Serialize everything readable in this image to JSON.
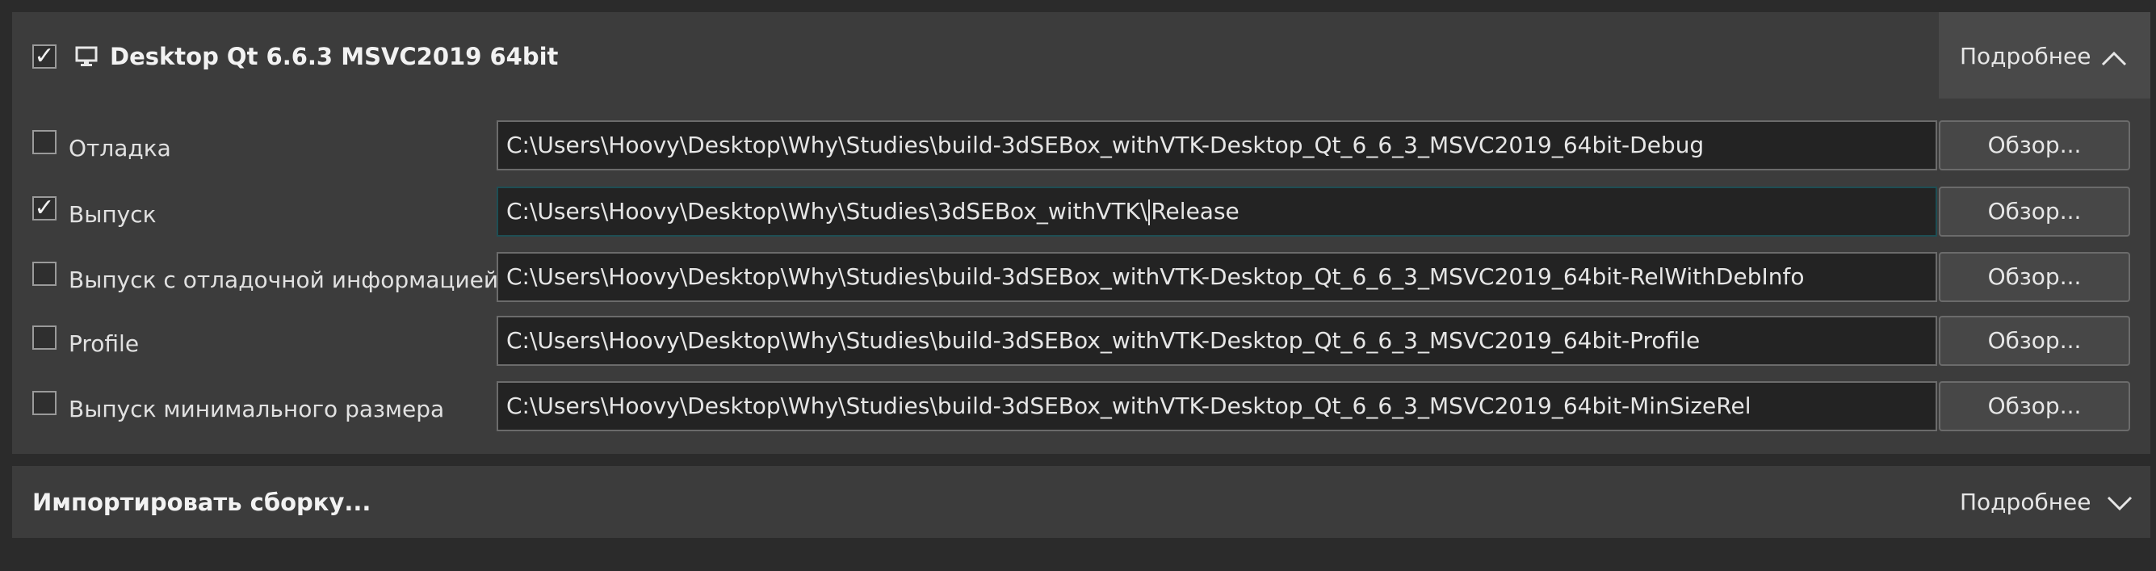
{
  "kit": {
    "checked": true,
    "title": "Desktop Qt 6.6.3 MSVC2019 64bit",
    "details_label": "Подробнее",
    "icon": "monitor-icon",
    "expanded": true
  },
  "build_configs": [
    {
      "name": "Отладка",
      "checked": false,
      "path_before_caret": "C:\\Users\\Hoovy\\Desktop\\Why\\Studies\\build-3dSEBox_withVTK-Desktop_Qt_6_6_3_MSVC2019_64bit-Debug",
      "path_after_caret": "",
      "browse_label": "Обзор..."
    },
    {
      "name": "Выпуск",
      "checked": true,
      "path_before_caret": "C:\\Users\\Hoovy\\Desktop\\Why\\Studies\\3dSEBox_withVTK\\",
      "path_after_caret": "Release",
      "browse_label": "Обзор..."
    },
    {
      "name": "Выпуск с отладочной информацией",
      "checked": false,
      "path_before_caret": "C:\\Users\\Hoovy\\Desktop\\Why\\Studies\\build-3dSEBox_withVTK-Desktop_Qt_6_6_3_MSVC2019_64bit-RelWithDebInfo",
      "path_after_caret": "",
      "browse_label": "Обзор..."
    },
    {
      "name": "Profile",
      "checked": false,
      "path_before_caret": "C:\\Users\\Hoovy\\Desktop\\Why\\Studies\\build-3dSEBox_withVTK-Desktop_Qt_6_6_3_MSVC2019_64bit-Profile",
      "path_after_caret": "",
      "browse_label": "Обзор..."
    },
    {
      "name": "Выпуск минимального размера",
      "checked": false,
      "path_before_caret": "C:\\Users\\Hoovy\\Desktop\\Why\\Studies\\build-3dSEBox_withVTK-Desktop_Qt_6_6_3_MSVC2019_64bit-MinSizeRel",
      "path_after_caret": "",
      "browse_label": "Обзор..."
    }
  ],
  "import_build": {
    "title": "Импортировать сборку...",
    "details_label": "Подробнее",
    "expanded": false
  },
  "colors": {
    "background": "#2b2b2b",
    "panel": "#3c3c3c",
    "field_bg": "#232323",
    "focus_border": "#1e4e54"
  }
}
